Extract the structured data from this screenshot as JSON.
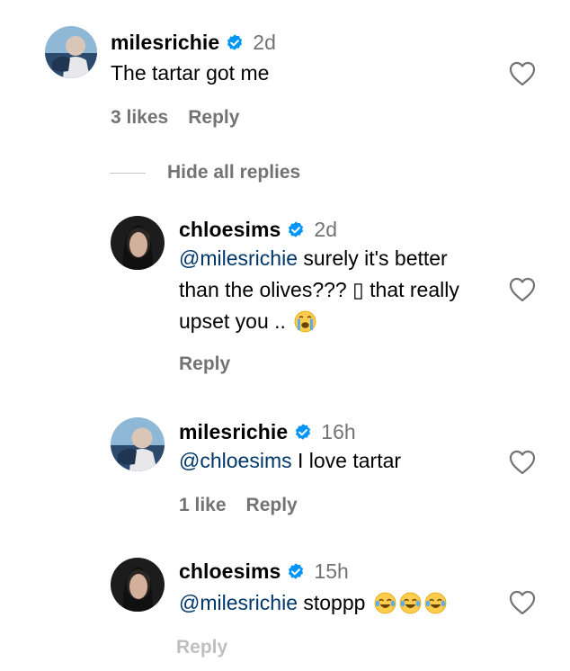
{
  "comments": [
    {
      "username": "milesrichie",
      "time": "2d",
      "text": "The tartar got me",
      "likes": "3 likes",
      "reply": "Reply"
    },
    {
      "username": "chloesims",
      "time": "2d",
      "mention": "@milesrichie",
      "text_line1": " surely it's better",
      "text_line2": "than the olives??? ▯ that really",
      "text_line3": "upset you .. ",
      "reply": "Reply"
    },
    {
      "username": "milesrichie",
      "time": "16h",
      "mention": "@chloesims",
      "text": " I love tartar",
      "likes": "1 like",
      "reply": "Reply"
    },
    {
      "username": "chloesims",
      "time": "15h",
      "mention": "@milesrichie",
      "text": " stoppp ",
      "reply": "Reply"
    }
  ],
  "thread": {
    "hide_replies": "Hide all replies"
  },
  "colors": {
    "verified": "#0095f6",
    "secondary_text": "#737373",
    "mention": "#00376b"
  },
  "icons": {
    "verified": "verified-badge-icon",
    "like": "heart-outline-icon",
    "crying": "loudly-crying-face-emoji",
    "laughing": "tears-of-joy-emoji"
  }
}
